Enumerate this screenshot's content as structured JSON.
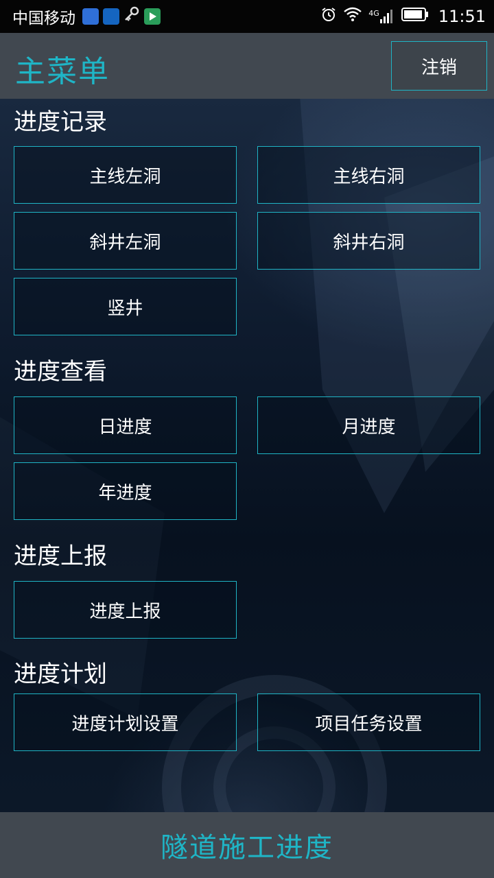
{
  "status_bar": {
    "carrier": "中国移动",
    "network": "4G",
    "time": "11:51"
  },
  "header": {
    "title": "主菜单",
    "logout_label": "注销"
  },
  "sections": {
    "record": {
      "title": "进度记录",
      "buttons": [
        "主线左洞",
        "主线右洞",
        "斜井左洞",
        "斜井右洞",
        "竖井"
      ]
    },
    "view": {
      "title": "进度查看",
      "buttons": [
        "日进度",
        "月进度",
        "年进度"
      ]
    },
    "report": {
      "title": "进度上报",
      "buttons": [
        "进度上报"
      ]
    },
    "plan": {
      "title": "进度计划",
      "buttons": [
        "进度计划设置",
        "项目任务设置"
      ]
    }
  },
  "footer": {
    "title": "隧道施工进度"
  },
  "colors": {
    "accent": "#1fb5c6",
    "bar": "#414850",
    "background": "#0a1628"
  }
}
